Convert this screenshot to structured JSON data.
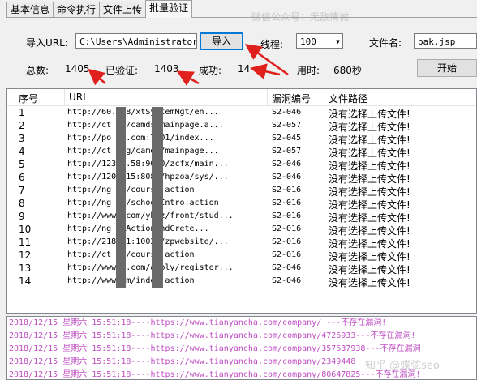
{
  "tabs": [
    {
      "label": "基本信息",
      "active": false
    },
    {
      "label": "命令执行",
      "active": false
    },
    {
      "label": "文件上传",
      "active": false
    },
    {
      "label": "批量验证",
      "active": true
    }
  ],
  "watermark_top": "微信公众号：无敌情诚",
  "watermark_bottom": "知乎 @蝶弦seo",
  "form": {
    "import_url_label": "导入URL:",
    "import_url_value": "C:\\Users\\Administrator\\D",
    "import_button": "导入",
    "threads_label": "线程:",
    "threads_value": "100",
    "filename_label": "文件名:",
    "filename_value": "bak.jsp",
    "total_label": "总数:",
    "total_value": "1405",
    "verified_label": "已验证:",
    "verified_value": "1403",
    "success_label": "成功:",
    "success_value": "14",
    "elapsed_label": "用时:",
    "elapsed_value": "680秒",
    "start_button": "开始"
  },
  "table": {
    "columns": [
      "序号",
      "URL",
      "漏洞编号",
      "文件路径"
    ],
    "rows": [
      {
        "n": "1",
        "url": "http://60.        88/xtSystemMgt/en...",
        "code": "S2-046",
        "path": "没有选择上传文件!"
      },
      {
        "n": "2",
        "url": "http://ct      or/camds/mainpage.a...",
        "code": "S2-057",
        "path": "没有选择上传文件!"
      },
      {
        "n": "3",
        "url": "http://po       ss.com:7001/index...",
        "code": "S2-045",
        "path": "没有选择上传文件!"
      },
      {
        "n": "4",
        "url": "http://ct      .og/camds/mainpage...",
        "code": "S2-057",
        "path": "没有选择上传文件!"
      },
      {
        "n": "5",
        "url": "http://123      9.58:9080/zcfx/main...",
        "code": "S2-046",
        "path": "没有选择上传文件!"
      },
      {
        "n": "6",
        "url": "http://120      .15:8088/hpzoa/sys/...",
        "code": "S2-046",
        "path": "没有选择上传文件!"
      },
      {
        "n": "7",
        "url": "http://ng       et/course.action",
        "code": "S2-016",
        "path": "没有选择上传文件!"
      },
      {
        "n": "8",
        "url": "http://ng       et/schoolIntro.action",
        "code": "S2-016",
        "path": "没有选择上传文件!"
      },
      {
        "n": "9",
        "url": "http://www      .com/yhcz/front/stud...",
        "code": "S2-016",
        "path": "没有选择上传文件!"
      },
      {
        "n": "10",
        "url": "http://ng       etActionAndCrete...",
        "code": "S2-016",
        "path": "没有选择上传文件!"
      },
      {
        "n": "11",
        "url": "http://218      21:10020/zpwebsite/...",
        "code": "S2-016",
        "path": "没有选择上传文件!"
      },
      {
        "n": "12",
        "url": "http://ct       ne/course.action",
        "code": "S2-016",
        "path": "没有选择上传文件!"
      },
      {
        "n": "13",
        "url": "http://www      u.com/apply/register...",
        "code": "S2-046",
        "path": "没有选择上传文件!"
      },
      {
        "n": "14",
        "url": "http://www      .m/index.action",
        "code": "S2-046",
        "path": "没有选择上传文件!"
      }
    ]
  },
  "log": [
    "2018/12/15 星期六 15:51:18----https://www.tianyancha.com/company/          ---不存在漏洞!",
    "2018/12/15 星期六 15:51:18----https://www.tianyancha.com/company/4726933---不存在漏洞!",
    "2018/12/15 星期六 15:51:18----https://www.tianyancha.com/company/357637938---不存在漏洞!",
    "2018/12/15 星期六 15:51:18----https://www.tianyancha.com/company/2349448",
    "2018/12/15 星期六 15:51:18----https://www.tianyancha.com/company/80647825---不存在漏洞!"
  ]
}
